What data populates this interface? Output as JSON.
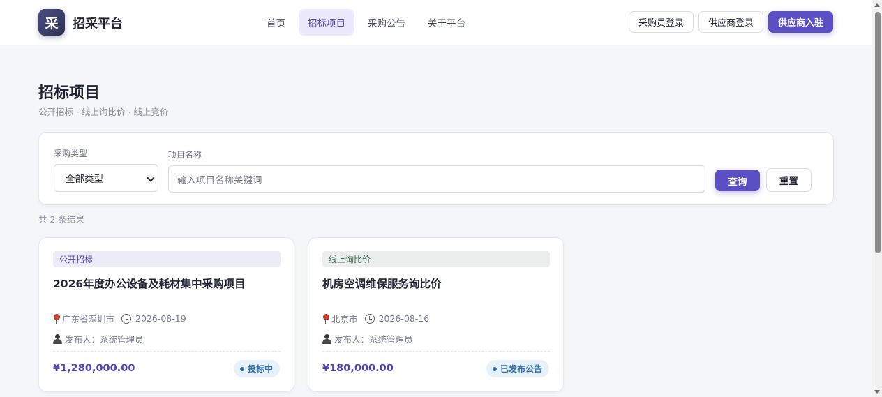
{
  "header": {
    "logo_char": "采",
    "brand": "招采平台",
    "nav": [
      "首页",
      "招标项目",
      "采购公告",
      "关于平台"
    ],
    "active_nav": "招标项目",
    "buyer_login": "采购员登录",
    "supplier_login": "供应商登录",
    "supplier_register": "供应商入驻"
  },
  "page": {
    "title": "招标项目",
    "subtitle": "公开招标 · 线上询比价 · 线上竞价"
  },
  "filter": {
    "type_label": "采购类型",
    "type_value": "全部类型",
    "name_label": "项目名称",
    "name_placeholder": "输入项目名称关键词",
    "query_label": "查询",
    "reset_label": "重置"
  },
  "result_count": "共 2 条结果",
  "projects": [
    {
      "tag": "公开招标",
      "title": "2026年度办公设备及耗材集中采购项目",
      "location": "广东省深圳市",
      "date": "2026-08-19",
      "publisher": "发布人：系统管理员",
      "price": "¥1,280,000.00",
      "status": "投标中"
    },
    {
      "tag": "线上询比价",
      "title": "机房空调维保服务询比价",
      "location": "北京市",
      "date": "2026-08-16",
      "publisher": "发布人：系统管理员",
      "price": "¥180,000.00",
      "status": "已发布公告"
    }
  ],
  "colors": {
    "accent": "#5b4fc4",
    "status_blue": "#2e70ad"
  },
  "icons": [
    "location-pin-icon",
    "clock-icon",
    "user-icon",
    "chevron-down-icon"
  ]
}
